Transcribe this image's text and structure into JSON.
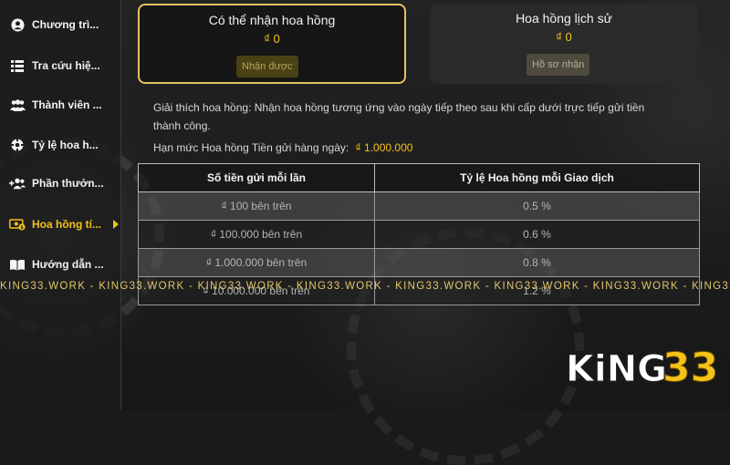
{
  "sidebar": {
    "items": [
      {
        "label": "Chương trì...",
        "icon": "user-icon"
      },
      {
        "label": "Tra cứu hiệ...",
        "icon": "list-icon"
      },
      {
        "label": "Thành viên ...",
        "icon": "members-icon"
      },
      {
        "label": "Tỷ lệ hoa h...",
        "icon": "commission-rate-icon"
      },
      {
        "label": "Phần thưởn...",
        "icon": "add-user-icon"
      },
      {
        "label": "Hoa hồng tí...",
        "icon": "money-icon",
        "active": true
      },
      {
        "label": "Hướng dẫn ...",
        "icon": "book-icon"
      }
    ]
  },
  "cards": {
    "available": {
      "title": "Có thể nhận hoa hồng",
      "value": "₫ 0",
      "button": "Nhận được"
    },
    "history": {
      "title": "Hoa hồng lịch sử",
      "value": "₫ 0",
      "button": "Hồ sơ nhận"
    }
  },
  "explanation": "Giải thích hoa hồng: Nhận hoa hồng tương ứng vào ngày tiếp theo sau khi cấp dưới trực tiếp gửi tiền thành công.",
  "limit": {
    "label": "Hạn mức Hoa hồng Tiền gửi hàng ngày:",
    "amount": "₫ 1.000.000"
  },
  "table": {
    "headers": [
      "Số tiền gửi mỗi lần",
      "Tỷ lệ Hoa hồng mỗi Giao dịch"
    ],
    "rows": [
      [
        "₫ 100 bên trên",
        "0.5 %"
      ],
      [
        "₫ 100.000 bên trên",
        "0.6 %"
      ],
      [
        "₫ 1.000.000 bên trên",
        "0.8 %"
      ],
      [
        "₫ 10.000.000 bên trên",
        "1.2 %"
      ]
    ]
  },
  "watermark": "KING33.WORK - KING33.WORK - KING33.WORK - KING33.WORK - KING33.WORK - KING33.WORK - KING33.WORK - KING33.WORK",
  "logo": {
    "text_main": "KiNG",
    "text_num": "33"
  },
  "colors": {
    "accent": "#f4c21a",
    "card_border": "#e3c35f",
    "background": "#1a1a1a"
  }
}
